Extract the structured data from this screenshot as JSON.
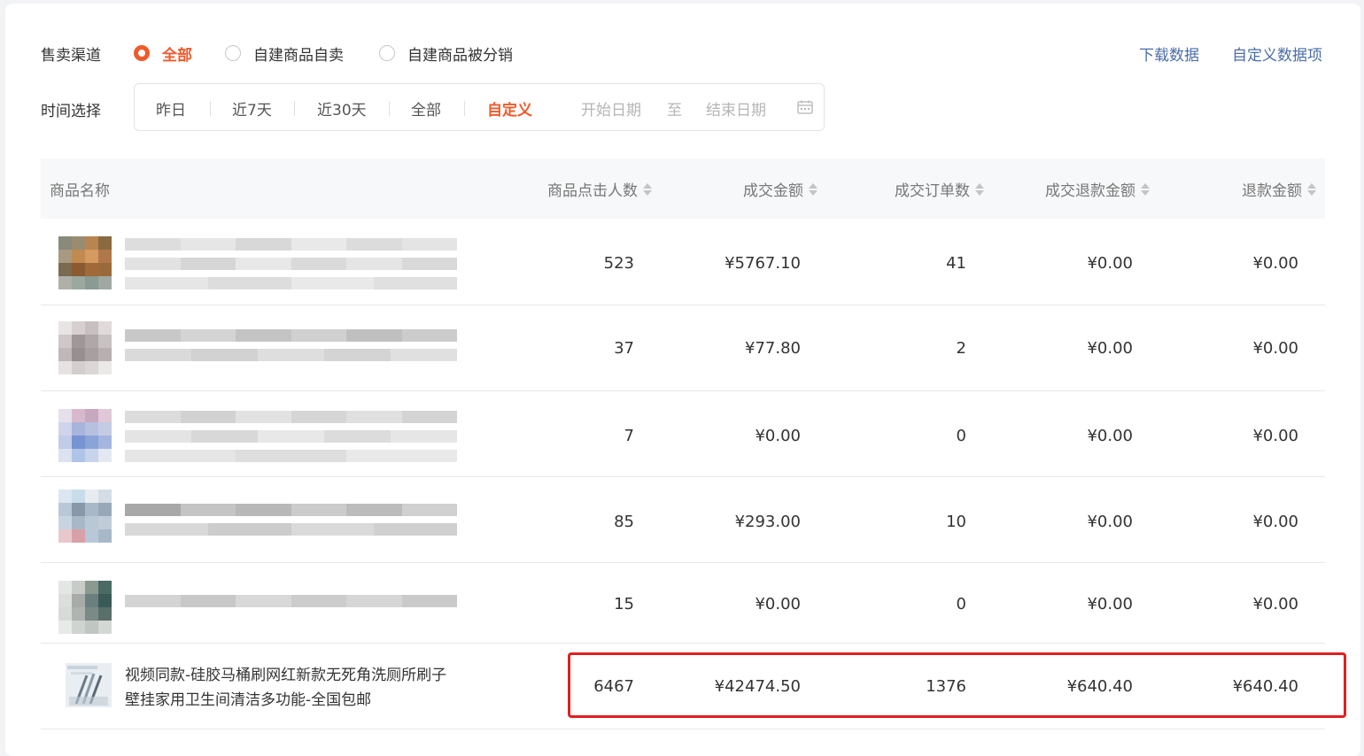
{
  "filters": {
    "channel_label": "售卖渠道",
    "channels": [
      {
        "label": "全部",
        "checked": true
      },
      {
        "label": "自建商品自卖",
        "checked": false
      },
      {
        "label": "自建商品被分销",
        "checked": false
      }
    ],
    "time_label": "时间选择",
    "time_options": [
      "昨日",
      "近7天",
      "近30天",
      "全部",
      "自定义"
    ],
    "active_time": "自定义",
    "start_placeholder": "开始日期",
    "to_label": "至",
    "end_placeholder": "结束日期"
  },
  "actions": {
    "download": "下载数据",
    "custom_fields": "自定义数据项"
  },
  "table": {
    "columns": [
      "商品名称",
      "商品点击人数",
      "成交金额",
      "成交订单数",
      "成交退款金额",
      "退款金额"
    ],
    "rows": [
      {
        "name": "",
        "clicks": "523",
        "amount": "¥5767.10",
        "orders": "41",
        "refund_deal": "¥0.00",
        "refund": "¥0.00"
      },
      {
        "name": "",
        "clicks": "37",
        "amount": "¥77.80",
        "orders": "2",
        "refund_deal": "¥0.00",
        "refund": "¥0.00"
      },
      {
        "name": "",
        "clicks": "7",
        "amount": "¥0.00",
        "orders": "0",
        "refund_deal": "¥0.00",
        "refund": "¥0.00"
      },
      {
        "name": "",
        "clicks": "85",
        "amount": "¥293.00",
        "orders": "10",
        "refund_deal": "¥0.00",
        "refund": "¥0.00"
      },
      {
        "name": "",
        "clicks": "15",
        "amount": "¥0.00",
        "orders": "0",
        "refund_deal": "¥0.00",
        "refund": "¥0.00"
      },
      {
        "name": "视频同款-硅胶马桶刷网红新款无死角洗厕所刷子壁挂家用卫生间清洁多功能-全国包邮",
        "clicks": "6467",
        "amount": "¥42474.50",
        "orders": "1376",
        "refund_deal": "¥640.40",
        "refund": "¥640.40",
        "highlighted": true
      }
    ]
  },
  "colors": {
    "accent": "#f05a2b",
    "link": "#4a6da7",
    "highlight_border": "#e02020"
  }
}
